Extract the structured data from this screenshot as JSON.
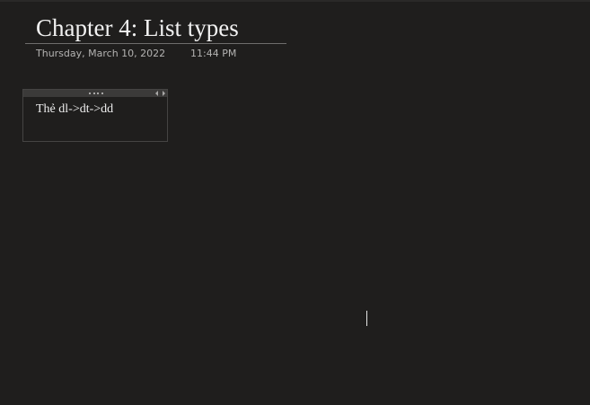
{
  "page": {
    "title": "Chapter 4: List types",
    "date": "Thursday, March 10, 2022",
    "time": "11:44 PM"
  },
  "note": {
    "text": "Thẻ dl->dt->dd"
  },
  "icons": {
    "handle": "drag-handle-icon",
    "resize": "resize-arrows-icon"
  }
}
